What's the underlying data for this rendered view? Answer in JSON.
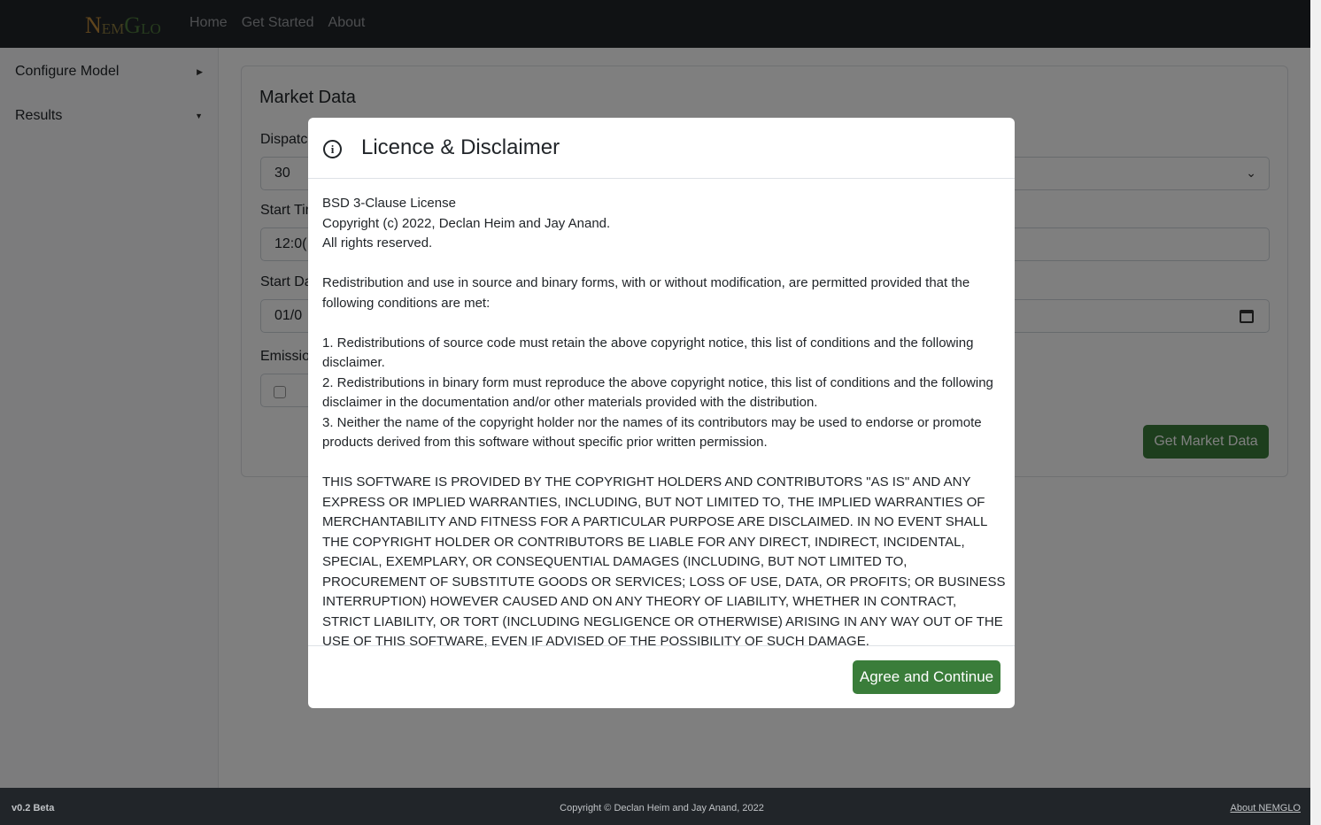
{
  "navbar": {
    "brand": {
      "p1": "N",
      "p2": "EM",
      "p3": "G",
      "p4": "LO"
    },
    "links": [
      "Home",
      "Get Started",
      "About"
    ]
  },
  "sidebar": {
    "items": [
      {
        "label": "Configure Model",
        "chevron": "right"
      },
      {
        "label": "Results",
        "chevron": "down"
      }
    ]
  },
  "market_card": {
    "title": "Market Data",
    "fields": {
      "dispatch": {
        "label": "Dispatc",
        "value": "30"
      },
      "start_time": {
        "label": "Start Tir",
        "value": "12:0("
      },
      "start_date": {
        "label": "Start Da",
        "value": "01/0"
      },
      "emissions": {
        "label": "Emissio"
      }
    },
    "get_button": "Get Market Data"
  },
  "modal": {
    "icon": "info-icon",
    "title": "Licence & Disclaimer",
    "license": {
      "header": [
        "BSD 3-Clause License",
        "Copyright (c) 2022, Declan Heim and Jay Anand.",
        "All rights reserved."
      ],
      "intro": "Redistribution and use in source and binary forms, with or without modification, are permitted provided that the following conditions are met:",
      "conditions": [
        "1. Redistributions of source code must retain the above copyright notice, this list of conditions and the following disclaimer.",
        "2. Redistributions in binary form must reproduce the above copyright notice, this list of conditions and the following disclaimer in the documentation and/or other materials provided with the distribution.",
        "3. Neither the name of the copyright holder nor the names of its contributors may be used to endorse or promote products derived from this software without specific prior written permission."
      ],
      "disclaimer": "THIS SOFTWARE IS PROVIDED BY THE COPYRIGHT HOLDERS AND CONTRIBUTORS \"AS IS\" AND ANY EXPRESS OR IMPLIED WARRANTIES, INCLUDING, BUT NOT LIMITED TO, THE IMPLIED WARRANTIES OF MERCHANTABILITY AND FITNESS FOR A PARTICULAR PURPOSE ARE DISCLAIMED. IN NO EVENT SHALL THE COPYRIGHT HOLDER OR CONTRIBUTORS BE LIABLE FOR ANY DIRECT, INDIRECT, INCIDENTAL, SPECIAL, EXEMPLARY, OR CONSEQUENTIAL DAMAGES (INCLUDING, BUT NOT LIMITED TO, PROCUREMENT OF SUBSTITUTE GOODS OR SERVICES; LOSS OF USE, DATA, OR PROFITS; OR BUSINESS INTERRUPTION) HOWEVER CAUSED AND ON ANY THEORY OF LIABILITY, WHETHER IN CONTRACT, STRICT LIABILITY, OR TORT (INCLUDING NEGLIGENCE OR OTHERWISE) ARISING IN ANY WAY OUT OF THE USE OF THIS SOFTWARE, EVEN IF ADVISED OF THE POSSIBILITY OF SUCH DAMAGE."
    },
    "agree_button": "Agree and Continue"
  },
  "footer": {
    "version": "v0.2 Beta",
    "copyright": "Copyright © Declan Heim and Jay Anand, 2022",
    "about_link": "About NEMGLO"
  },
  "colors": {
    "navbar_bg": "#212529",
    "button_green": "#3a7d3a",
    "backdrop": "rgba(0,0,0,0.5)"
  }
}
